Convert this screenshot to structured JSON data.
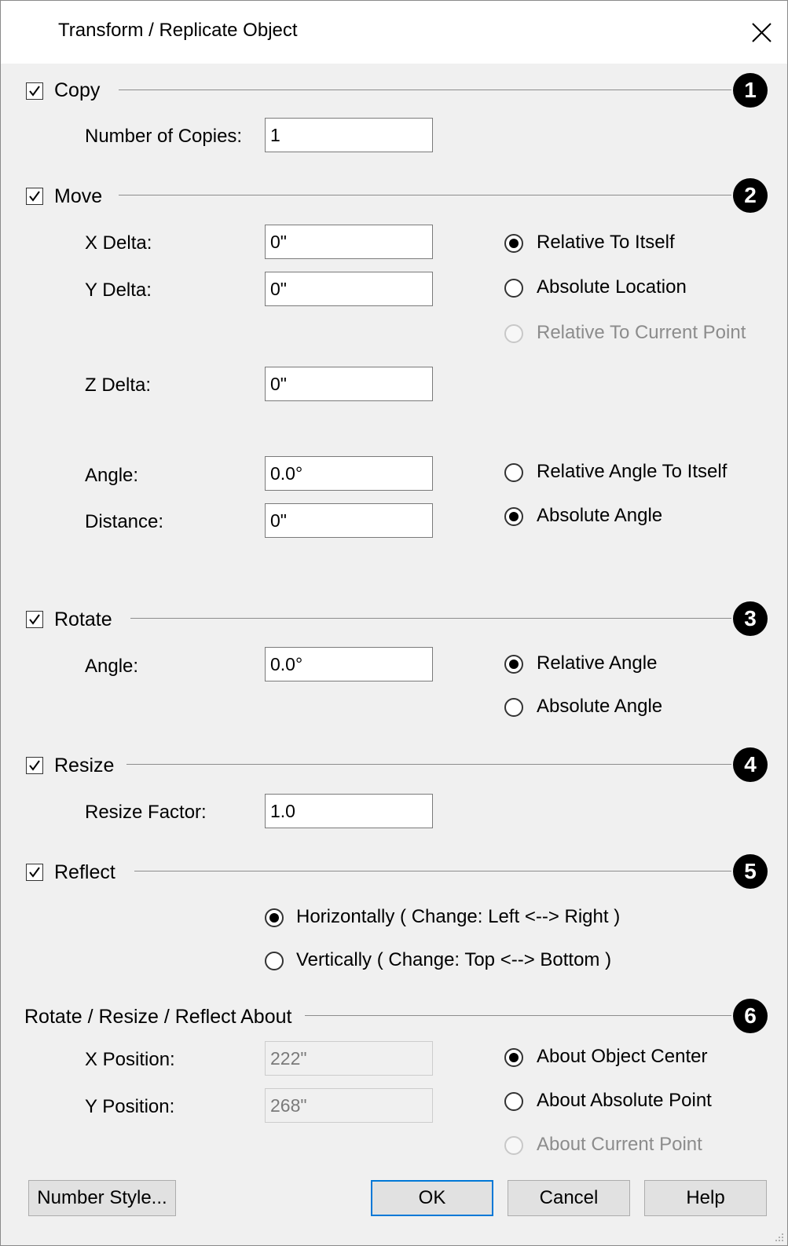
{
  "dialog": {
    "title": "Transform / Replicate Object"
  },
  "copy": {
    "label": "Copy",
    "checked": true,
    "badge": "1",
    "copies_label": "Number of Copies:",
    "copies_value": "1"
  },
  "move": {
    "label": "Move",
    "checked": true,
    "badge": "2",
    "x_label": "X Delta:",
    "x_value": "0\"",
    "y_label": "Y Delta:",
    "y_value": "0\"",
    "z_label": "Z Delta:",
    "z_value": "0\"",
    "angle_label": "Angle:",
    "angle_value": "0.0°",
    "distance_label": "Distance:",
    "distance_value": "0\"",
    "loc_options": [
      "Relative To Itself",
      "Absolute Location",
      "Relative To Current Point"
    ],
    "loc_selected": "Relative To Itself",
    "angle_options": [
      "Relative Angle To Itself",
      "Absolute Angle"
    ],
    "angle_selected": "Absolute Angle"
  },
  "rotate": {
    "label": "Rotate",
    "checked": true,
    "badge": "3",
    "angle_label": "Angle:",
    "angle_value": "0.0°",
    "options": [
      "Relative Angle",
      "Absolute Angle"
    ],
    "selected": "Relative Angle"
  },
  "resize": {
    "label": "Resize",
    "checked": true,
    "badge": "4",
    "factor_label": "Resize Factor:",
    "factor_value": "1.0"
  },
  "reflect": {
    "label": "Reflect",
    "checked": true,
    "badge": "5",
    "options": [
      "Horizontally ( Change: Left <--> Right )",
      "Vertically ( Change: Top <--> Bottom )"
    ],
    "selected": "Horizontally ( Change: Left <--> Right )"
  },
  "about": {
    "label": "Rotate / Resize / Reflect About",
    "badge": "6",
    "x_label": "X Position:",
    "x_value": "222\"",
    "y_label": "Y Position:",
    "y_value": "268\"",
    "options": [
      "About Object Center",
      "About Absolute Point",
      "About Current Point"
    ],
    "selected": "About Object Center"
  },
  "buttons": {
    "number_style": "Number Style...",
    "ok": "OK",
    "cancel": "Cancel",
    "help": "Help"
  },
  "icons": {
    "close": "close-icon",
    "check": "checkmark-icon",
    "grip": "resize-grip-icon"
  },
  "colors": {
    "dialog_bg": "#f0f0f0",
    "default_button_border": "#0078d7",
    "disabled_text": "#8c8c8c"
  }
}
